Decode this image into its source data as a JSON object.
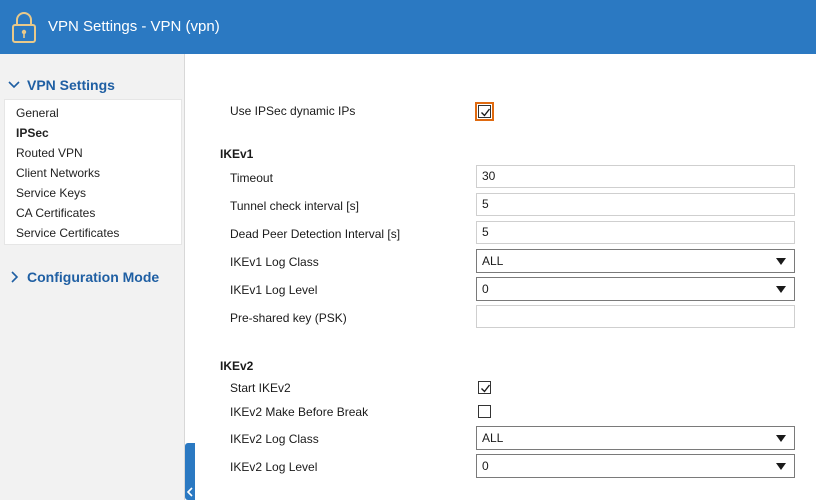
{
  "window": {
    "title": "VPN Settings - VPN (vpn)",
    "icon": "lock-icon"
  },
  "sidebar": {
    "sections": [
      {
        "label": "VPN Settings",
        "expanded": true
      },
      {
        "label": "Configuration Mode",
        "expanded": false
      }
    ],
    "items": [
      {
        "label": "General"
      },
      {
        "label": "IPSec",
        "active": true
      },
      {
        "label": "Routed VPN"
      },
      {
        "label": "Client Networks"
      },
      {
        "label": "Service Keys"
      },
      {
        "label": "CA Certificates"
      },
      {
        "label": "Service Certificates"
      }
    ]
  },
  "form": {
    "dynamic_ips": {
      "label": "Use IPSec dynamic IPs",
      "checked": true
    },
    "ikev1": {
      "heading": "IKEv1",
      "timeout": {
        "label": "Timeout",
        "value": "30"
      },
      "tunnel_check": {
        "label": "Tunnel check interval [s]",
        "value": "5"
      },
      "dpd_interval": {
        "label": "Dead Peer Detection Interval [s]",
        "value": "5"
      },
      "log_class": {
        "label": "IKEv1 Log Class",
        "value": "ALL"
      },
      "log_level": {
        "label": "IKEv1 Log Level",
        "value": "0"
      },
      "psk": {
        "label": "Pre-shared key (PSK)",
        "value": ""
      }
    },
    "ikev2": {
      "heading": "IKEv2",
      "start": {
        "label": "Start IKEv2",
        "checked": true
      },
      "make_before_break": {
        "label": "IKEv2 Make Before Break",
        "checked": false
      },
      "log_class": {
        "label": "IKEv2 Log Class",
        "value": "ALL"
      },
      "log_level": {
        "label": "IKEv2 Log Level",
        "value": "0"
      }
    }
  },
  "colors": {
    "titlebar": "#2b79c2",
    "sidebar_heading": "#1f5fa3",
    "focus_outline": "#e06a10"
  }
}
